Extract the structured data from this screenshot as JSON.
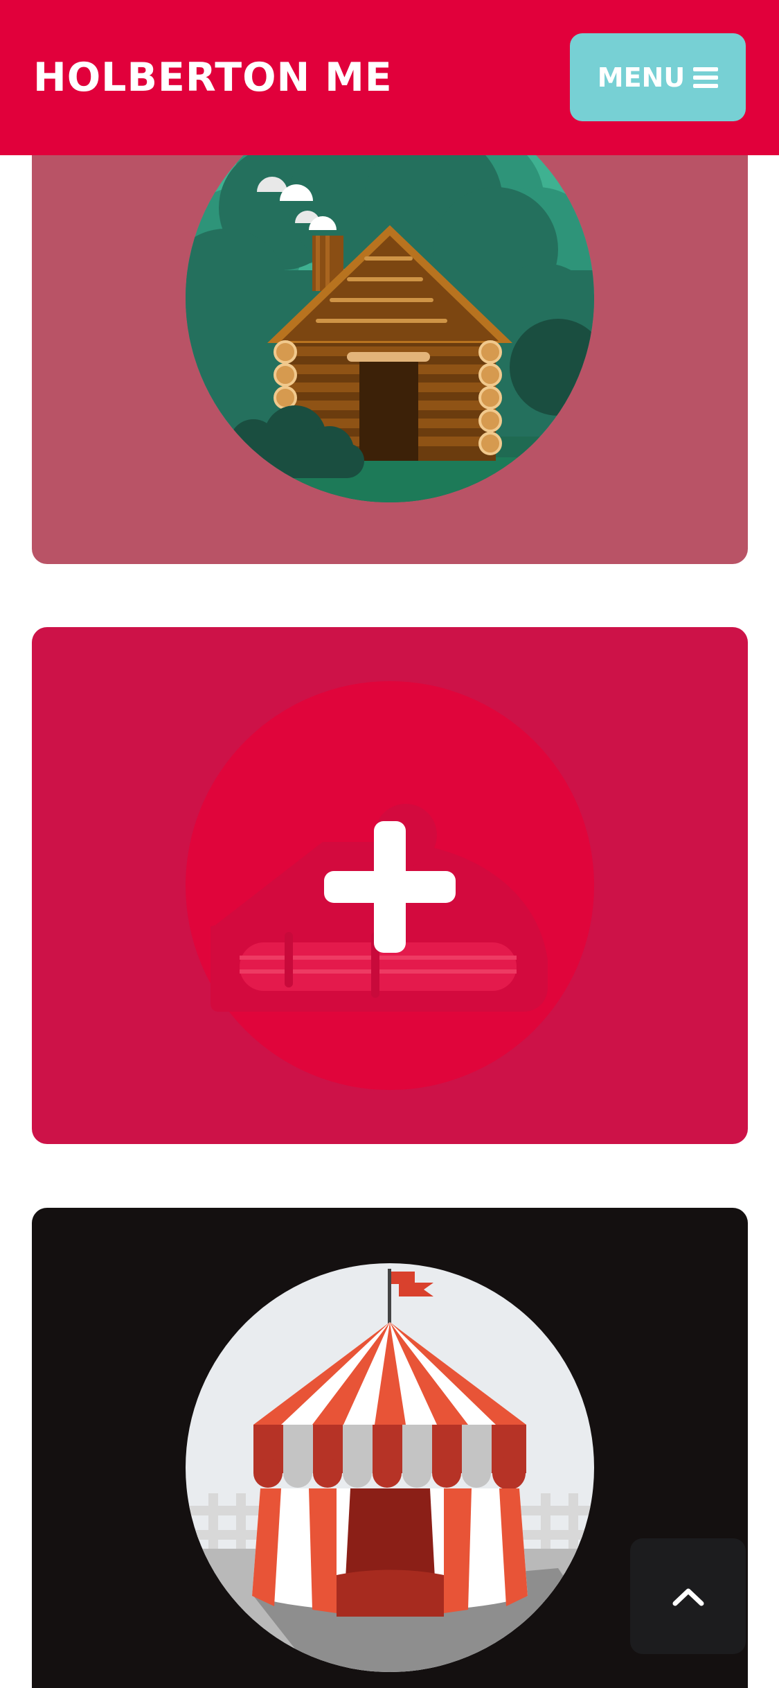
{
  "header": {
    "brand": "HOLBERTON ME",
    "menu_label": "MENU",
    "menu_icon": "hamburger-icon"
  },
  "cards": [
    {
      "illustration": "log-cabin",
      "color": "#b95366"
    },
    {
      "illustration": "add-project-placeholder",
      "action_icon": "plus-icon",
      "color": "#cd1248"
    },
    {
      "illustration": "circus-tent",
      "color": "#141010"
    }
  ],
  "scroll_top": {
    "icon": "chevron-up-icon"
  },
  "colors": {
    "header": "#e1003b",
    "menu_button": "#77d0d4",
    "white": "#ffffff"
  }
}
